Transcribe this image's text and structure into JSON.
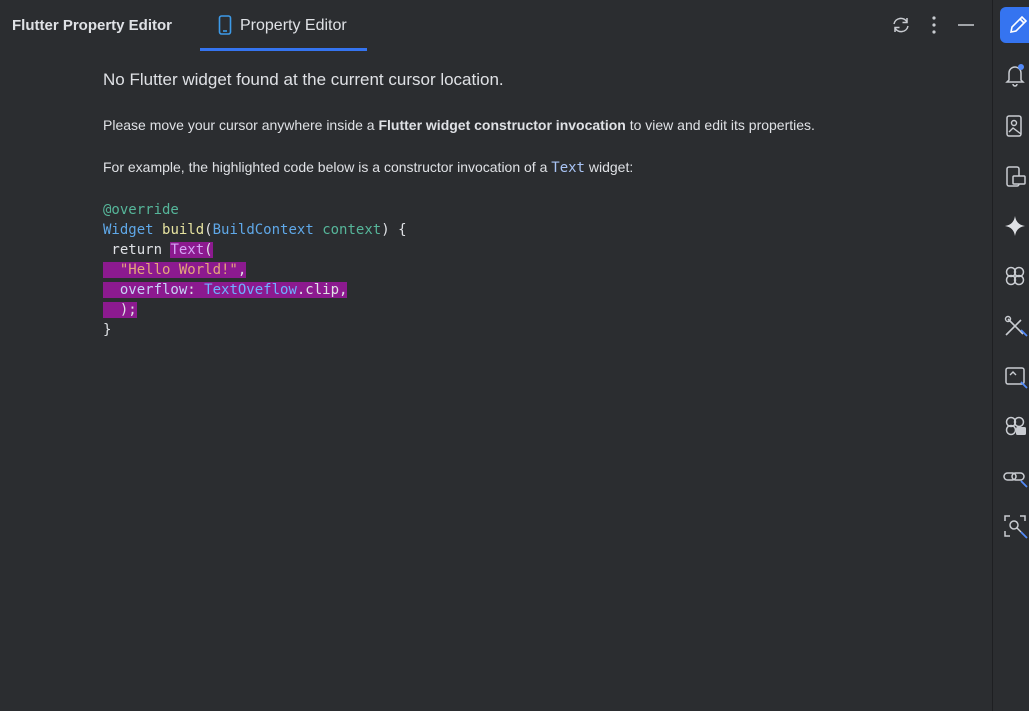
{
  "header": {
    "title": "Flutter Property Editor",
    "tab_label": "Property Editor",
    "icons": [
      "phone-icon",
      "refresh-icon",
      "more-vertical-icon",
      "minimize-icon"
    ]
  },
  "main": {
    "heading": "No Flutter widget found at the current cursor location.",
    "para1_before": "Please move your cursor anywhere inside a ",
    "para1_bold": "Flutter widget constructor invocation",
    "para1_after": " to view and edit its properties.",
    "para2_before": "For example, the highlighted code below is a constructor invocation of a ",
    "para2_code": "Text",
    "para2_after": " widget:",
    "code": {
      "l1": "@override",
      "l2_type": "Widget",
      "l2_sp": " ",
      "l2_fn": "build",
      "l2_p1": "(",
      "l2_type2": "BuildContext",
      "l2_sp2": " ",
      "l2_param": "context",
      "l2_end": ") {",
      "l3_kw": " return ",
      "l3_cls": "Text",
      "l3_paren": "(",
      "l4_pad": "  ",
      "l4_str": "\"Hello World!\"",
      "l4_comma": ",",
      "l5_pad": "  ",
      "l5_prop": "overflow",
      "l5_colon": ": ",
      "l5_cls": "TextOveflow",
      "l5_end": ".clip,",
      "l6": "  );",
      "l7": "}"
    }
  },
  "toolstrip": {
    "icons": [
      "property-editor-icon",
      "notifications-icon",
      "device-manager-icon",
      "running-devices-icon",
      "gemini-icon",
      "app-quality-icon",
      "build-tools-icon",
      "layout-inspector-icon",
      "app-inspection-icon",
      "link-icon",
      "profiler-icon"
    ]
  },
  "colors": {
    "background": "#2b2d30",
    "accent": "#3574f0",
    "highlight": "#8c1a8f"
  }
}
